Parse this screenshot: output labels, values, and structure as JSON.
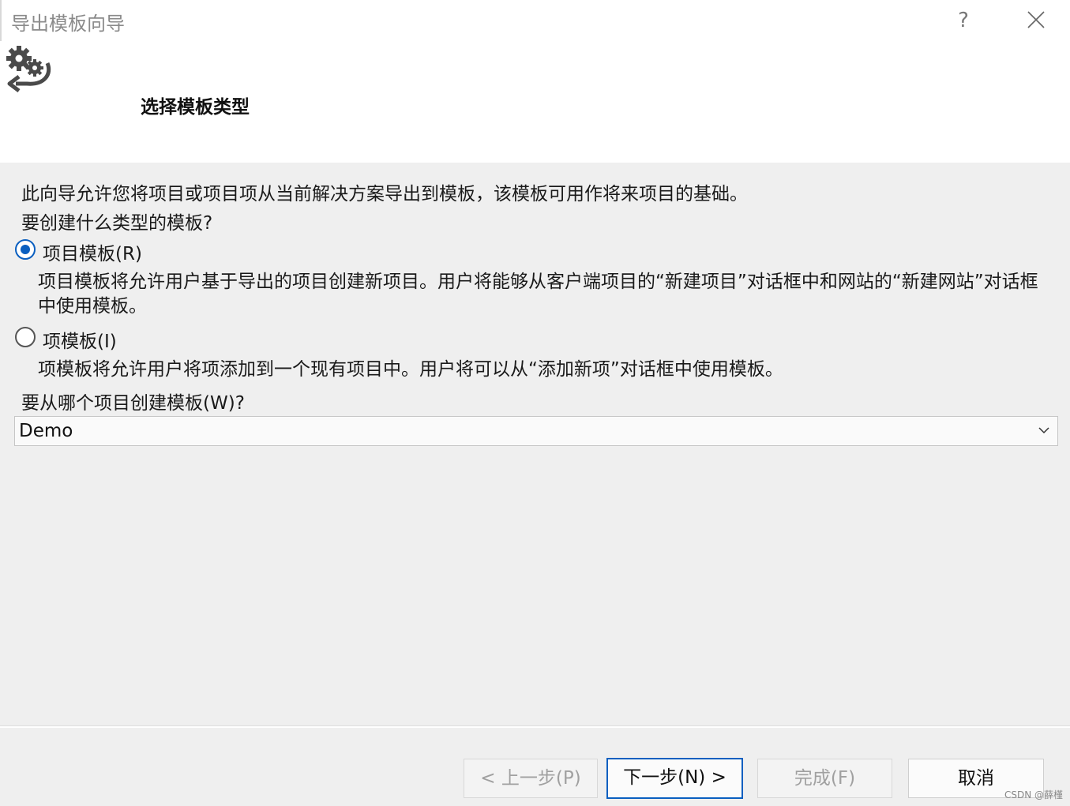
{
  "window": {
    "title": "导出模板向导",
    "help_label": "?",
    "close_icon": "close-icon"
  },
  "header": {
    "icon": "gears-export-icon",
    "title": "选择模板类型"
  },
  "content": {
    "intro": "此向导允许您将项目或项目项从当前解决方案导出到模板，该模板可用作将来项目的基础。",
    "question": "要创建什么类型的模板?",
    "options": [
      {
        "label": "项目模板(R)",
        "checked": true,
        "description": "项目模板将允许用户基于导出的项目创建新项目。用户将能够从客户端项目的“新建项目”对话框中和网站的“新建网站”对话框中使用模板。"
      },
      {
        "label": "项模板(I)",
        "checked": false,
        "description": "项模板将允许用户将项添加到一个现有项目中。用户将可以从“添加新项”对话框中使用模板。"
      }
    ],
    "project_question": "要从哪个项目创建模板(W)?",
    "project_select": {
      "value": "Demo",
      "icon": "chevron-down-icon"
    }
  },
  "buttons": {
    "back": "< 上一步(P)",
    "next": "下一步(N) >",
    "finish": "完成(F)",
    "cancel": "取消"
  },
  "watermark": "CSDN @薛槿",
  "colors": {
    "accent": "#0a5fc0",
    "content_bg": "#efefef",
    "header_bg": "#ffffff"
  }
}
